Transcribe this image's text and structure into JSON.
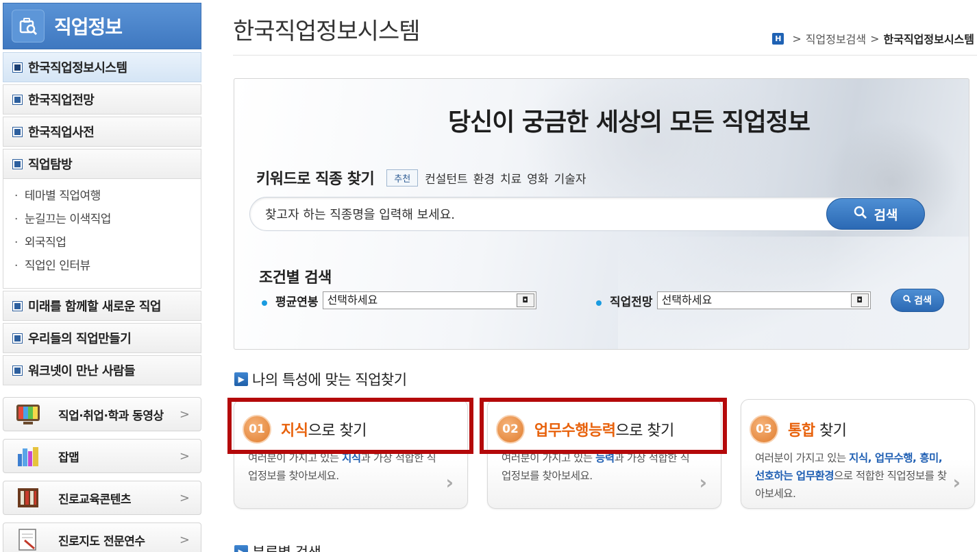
{
  "sidebar": {
    "title": "직업정보",
    "menu": [
      {
        "label": "한국직업정보시스템",
        "active": true
      },
      {
        "label": "한국직업전망"
      },
      {
        "label": "한국직업사전"
      },
      {
        "label": "직업탐방"
      }
    ],
    "submenu": [
      "테마별 직업여행",
      "눈길끄는 이색직업",
      "외국직업",
      "직업인 인터뷰"
    ],
    "menu2": [
      {
        "label": "미래를 함께할 새로운 직업"
      },
      {
        "label": "우리들의 직업만들기"
      },
      {
        "label": "워크넷이 만난 사람들"
      }
    ],
    "quick_links": [
      {
        "label": "직업·취업·학과 동영상",
        "icon": "tv-icon"
      },
      {
        "label": "잡맵",
        "icon": "map-icon"
      },
      {
        "label": "진로교육콘텐츠",
        "icon": "books-icon"
      },
      {
        "label": "진로지도 전문연수",
        "icon": "document-icon"
      }
    ]
  },
  "header": {
    "title": "한국직업정보시스템",
    "breadcrumb": [
      "직업정보검색",
      "한국직업정보시스템"
    ],
    "home_glyph": "H"
  },
  "search": {
    "headline": "당신이 궁금한 세상의 모든 직업정보",
    "keyword_title": "키워드로 직종 찾기",
    "recommend_badge": "추천",
    "keywords": [
      "컨설턴트",
      "환경",
      "치료",
      "영화",
      "기술자"
    ],
    "placeholder": "찾고자 하는 직종명을 입력해 보세요.",
    "button": "검색"
  },
  "condition": {
    "title": "조건별 검색",
    "salary_label": "평균연봉",
    "salary_value": "선택하세요",
    "outlook_label": "직업전망",
    "outlook_value": "선택하세요",
    "button": "검색"
  },
  "traits": {
    "title": "나의 특성에 맞는 직업찾기",
    "cards": [
      {
        "num": "01",
        "highlight": "지식",
        "rest": "으로 찾기",
        "desc_a": "여러분이 가지고 있는 ",
        "desc_hl": "지식",
        "desc_b": "과 가장 적합한 직업정보를 찾아보세요."
      },
      {
        "num": "02",
        "highlight": "업무수행능력",
        "rest": "으로 찾기",
        "desc_a": "여러분이 가지고 있는 ",
        "desc_hl": "능력",
        "desc_b": "과 가장 적합한 직업정보를 찾아보세요."
      },
      {
        "num": "03",
        "highlight": "통합",
        "rest": " 찾기",
        "desc_a": "여러분이 가지고 있는 ",
        "desc_hl": "지식, 업무수행, 흥미, 선호하는 업무환경",
        "desc_b": "으로 적합한 직업정보를 찾아보세요."
      }
    ]
  },
  "next_section": {
    "title": "분류별 검색"
  },
  "colors": {
    "accent": "#2b69b4",
    "highlight": "#e8620c",
    "annotation": "#b4090a"
  }
}
